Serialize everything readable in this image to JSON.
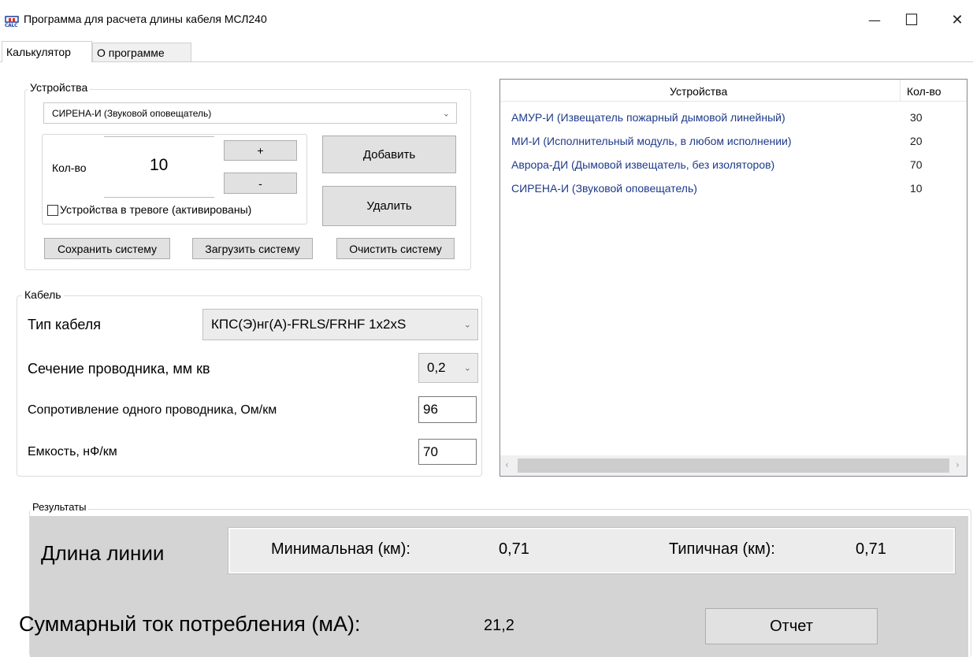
{
  "window": {
    "icon_text": "CALC",
    "title": "Программа для расчета длины кабеля МСЛ240",
    "minimize": "—",
    "maximize": "☐",
    "close": "✕"
  },
  "tabs": [
    {
      "label": "Калькулятор"
    },
    {
      "label": "О программе"
    }
  ],
  "devices_group": {
    "title": "Устройства",
    "device_select": "СИРЕНА-И (Звуковой оповещатель)",
    "qty_label": "Кол-во",
    "qty_value": "10",
    "plus_label": "+",
    "minus_label": "-",
    "add_label": "Добавить",
    "remove_label": "Удалить",
    "alarm_checkbox_label": "Устройства в тревоге (активированы)",
    "alarm_checked": false,
    "save_label": "Сохранить систему",
    "load_label": "Загрузить систему",
    "clear_label": "Очистить систему"
  },
  "cable_group": {
    "title": "Кабель",
    "type_label": "Тип кабеля",
    "type_value": "КПС(Э)нг(А)-FRLS/FRHF 1х2хS",
    "section_label": "Сечение проводника, мм кв",
    "section_value": "0,2",
    "resistance_label": "Сопротивление одного проводника, Ом/км",
    "resistance_value": "96",
    "capacitance_label": "Емкость, нФ/км",
    "capacitance_value": "70"
  },
  "device_list": {
    "col_devices": "Устройства",
    "col_qty": "Кол-во",
    "rows": [
      {
        "name": "АМУР-И (Извещатель пожарный дымовой линейный)",
        "qty": "30"
      },
      {
        "name": "МИ-И (Исполнительный модуль, в любом исполнении)",
        "qty": "20"
      },
      {
        "name": "Аврора-ДИ (Дымовой извещатель, без изоляторов)",
        "qty": "70"
      },
      {
        "name": "СИРЕНА-И (Звуковой оповещатель)",
        "qty": "10"
      }
    ]
  },
  "results": {
    "title": "Результаты",
    "line_length_label": "Длина линии",
    "min_label": "Минимальная (км):",
    "min_value": "0,71",
    "typical_label": "Типичная (км):",
    "typical_value": "0,71",
    "current_label": "Суммарный ток потребления (мА):",
    "current_value": "21,2",
    "report_label": "Отчет"
  }
}
